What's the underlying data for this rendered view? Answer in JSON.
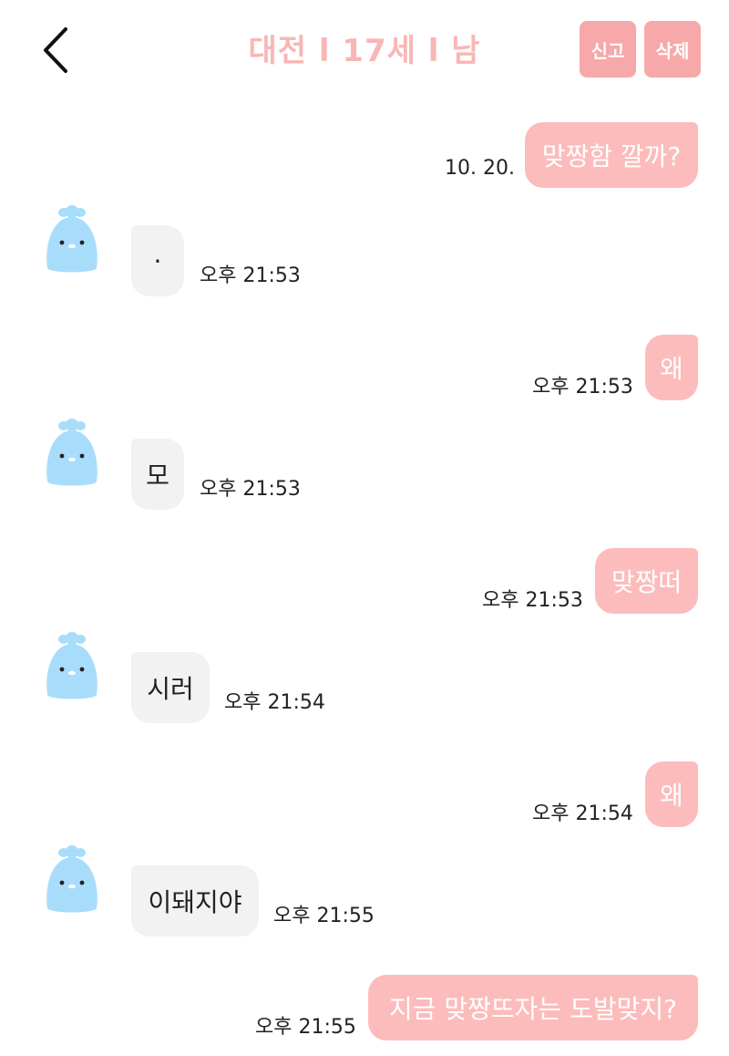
{
  "header": {
    "title": "대전 l 17세 l 남",
    "report_label": "신고",
    "delete_label": "삭제"
  },
  "colors": {
    "accent": "#f7a8a8",
    "title": "#f9b6b5",
    "my_bubble": "#fcbcbc",
    "their_bubble": "#f2f2f2",
    "avatar": "#a8dcfb"
  },
  "messages": [
    {
      "from": "me",
      "text": "맞짱함 깔까?",
      "time": "10. 20."
    },
    {
      "from": "them",
      "text": "·",
      "time": "오후 21:53"
    },
    {
      "from": "me",
      "text": "왜",
      "time": "오후 21:53"
    },
    {
      "from": "them",
      "text": "모",
      "time": "오후 21:53"
    },
    {
      "from": "me",
      "text": "맞짱떠",
      "time": "오후 21:53"
    },
    {
      "from": "them",
      "text": "시러",
      "time": "오후 21:54"
    },
    {
      "from": "me",
      "text": "왜",
      "time": "오후 21:54"
    },
    {
      "from": "them",
      "text": "이돼지야",
      "time": "오후 21:55"
    },
    {
      "from": "me",
      "text": "지금 맞짱뜨자는 도발맞지?",
      "time": "오후 21:55"
    }
  ]
}
